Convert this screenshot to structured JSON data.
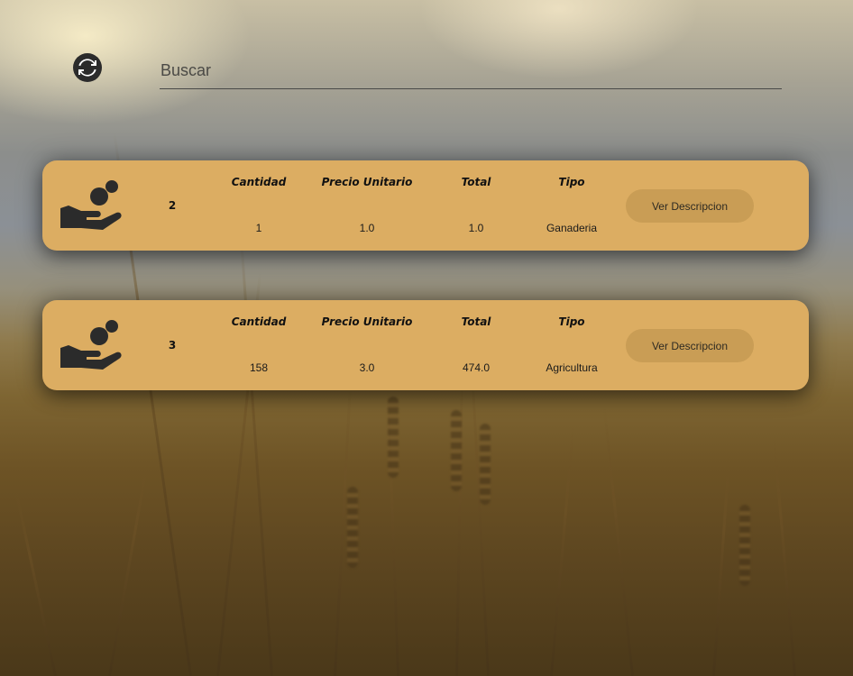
{
  "search": {
    "placeholder": "Buscar",
    "value": ""
  },
  "icons": {
    "refresh": "refresh-icon",
    "product": "hand-coin-icon"
  },
  "colors": {
    "card_background": "#dcad62",
    "button_background": "#c99d55",
    "icon_color": "#2b2b2b"
  },
  "columns": {
    "cantidad": "Cantidad",
    "precio_unitario": "Precio Unitario",
    "total": "Total",
    "tipo": "Tipo"
  },
  "button_label": "Ver Descripcion",
  "cards": [
    {
      "id": "2",
      "cantidad": "1",
      "precio_unitario": "1.0",
      "total": "1.0",
      "tipo": "Ganaderia"
    },
    {
      "id": "3",
      "cantidad": "158",
      "precio_unitario": "3.0",
      "total": "474.0",
      "tipo": "Agricultura"
    }
  ]
}
